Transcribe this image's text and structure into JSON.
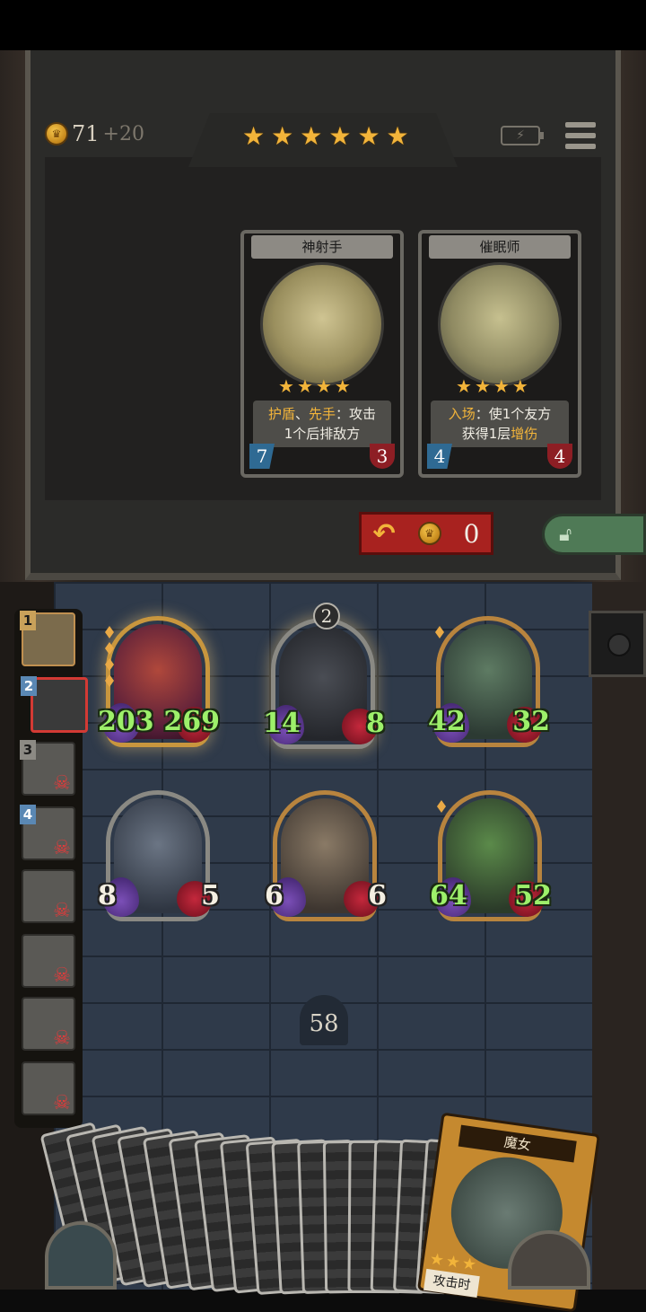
{
  "gold": {
    "amount": "71",
    "income": "+20"
  },
  "tier_stars": 6,
  "shop": {
    "cards": [
      {
        "name": "神射手",
        "stars": 4,
        "desc_parts": [
          [
            "护盾",
            true
          ],
          [
            "、",
            false
          ],
          [
            "先手",
            true
          ],
          [
            "：攻击",
            false
          ]
        ],
        "desc_line2": "1个后排敌方",
        "attack": "7",
        "health": "3"
      },
      {
        "name": "催眠师",
        "stars": 4,
        "desc_line1_hl": "入场",
        "desc_line1_rest": "：使1个友方",
        "desc_line2_plain": "获得1层",
        "desc_line2_hl": "增伤",
        "attack": "4",
        "health": "4"
      }
    ],
    "refresh_cost": "0"
  },
  "rank": [
    {
      "num": "1",
      "style": "me"
    },
    {
      "num": "2",
      "style": "active"
    },
    {
      "num": "3",
      "style": "dead"
    },
    {
      "num": "4",
      "style": "dead"
    },
    {
      "num": "",
      "style": "dead"
    },
    {
      "num": "",
      "style": "dead"
    },
    {
      "num": "",
      "style": "dead"
    },
    {
      "num": "",
      "style": "dead"
    }
  ],
  "board": {
    "front": [
      {
        "attack": "203",
        "health": "269",
        "buffed": true,
        "frame": "gold"
      },
      {
        "attack": "14",
        "health": "8",
        "buffed": false,
        "frame": "grey",
        "tier": "2"
      },
      {
        "attack": "42",
        "health": "32",
        "buffed": true,
        "frame": "gold"
      }
    ],
    "back": [
      {
        "attack": "8",
        "health": "5",
        "buffed": false,
        "frame": "grey"
      },
      {
        "attack": "6",
        "health": "6",
        "buffed": false,
        "frame": "gold"
      },
      {
        "attack": "64",
        "health": "52",
        "buffed": true,
        "frame": "gold"
      }
    ]
  },
  "deck_count": "58",
  "hand": {
    "back_count": 17,
    "featured": {
      "name": "魔女",
      "stars": 3,
      "desc": "攻击时"
    }
  }
}
